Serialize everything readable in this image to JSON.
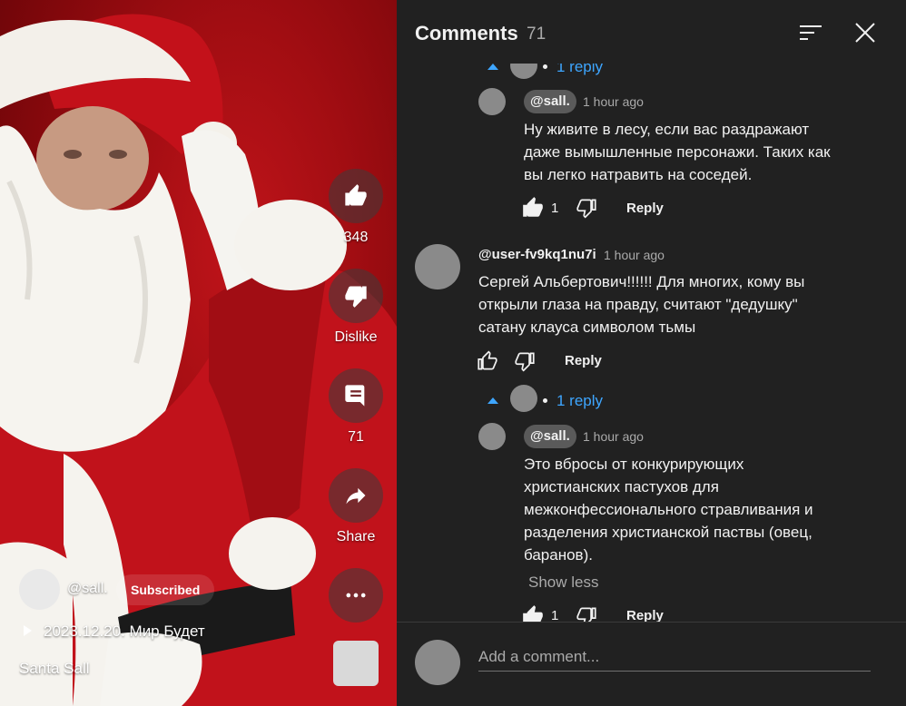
{
  "video": {
    "actions": {
      "like_count": "348",
      "dislike_label": "Dislike",
      "comment_count": "71",
      "share_label": "Share"
    },
    "channel": {
      "handle": "@sall.",
      "subscribed_label": "Subscribed"
    },
    "title": "2023.12.20. Мир Будет",
    "author": "Santa Sall"
  },
  "panel": {
    "title": "Comments",
    "count": "71",
    "top_toggle_label": "1 reply",
    "comments": [
      {
        "author": "@sall.",
        "time": "1 hour ago",
        "lines": [
          "Ну живите в лесу, если вас раздражают",
          "даже вымышленные персонажи. Таких как",
          "вы легко натравить на соседей."
        ],
        "likes": "1",
        "reply_label": "Reply"
      },
      {
        "author": "@user-fv9kq1nu7i",
        "time": "1 hour ago",
        "lines": [
          "Сергей Альбертович!!!!!! Для многих, кому вы",
          "открыли глаза на правду, считают \"дедушку\"",
          "сатану клауса символом тьмы"
        ],
        "reply_label": "Reply",
        "toggle_label": "1 reply"
      },
      {
        "author": "@sall.",
        "time": "1 hour ago",
        "lines": [
          "Это вбросы от конкурирующих",
          "христианских пастухов для",
          "межконфессионального стравливания и",
          "разделения христианской паствы (овец,",
          "баранов)."
        ],
        "show_less_label": "Show less",
        "likes": "1",
        "reply_label": "Reply"
      }
    ],
    "composer_placeholder": "Add a comment..."
  },
  "colors": {
    "accent_blue": "#3ea6ff",
    "panel_bg": "#212121",
    "video_red": "#a10d12"
  },
  "icons": [
    "thumb-up-icon",
    "thumb-down-icon",
    "comment-icon",
    "share-icon",
    "more-icon",
    "sort-icon",
    "close-icon",
    "play-icon"
  ]
}
